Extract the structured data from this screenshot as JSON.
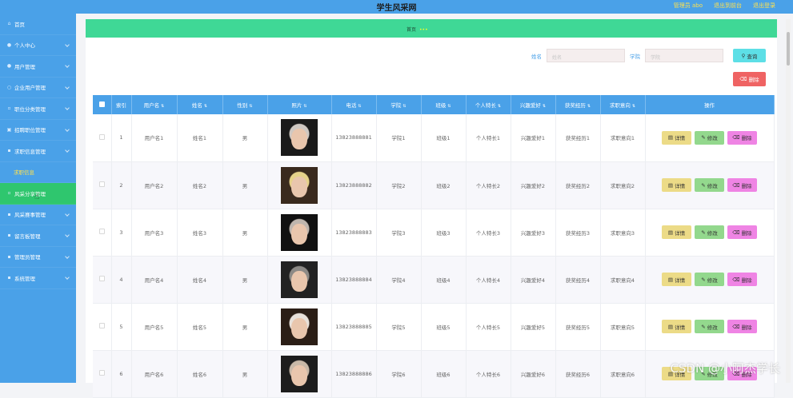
{
  "app": {
    "title": "学生风采网"
  },
  "header": {
    "admin_label": "管理员 abo",
    "exit_frontend": "退出到前台",
    "logout": "退出登录"
  },
  "sidebar": {
    "items": [
      {
        "label": "首页",
        "icon": "home-icon"
      },
      {
        "label": "个人中心",
        "icon": "user-icon"
      },
      {
        "label": "用户管理",
        "icon": "users-icon"
      },
      {
        "label": "企业用户管理",
        "icon": "building-icon"
      },
      {
        "label": "职位分类管理",
        "icon": "category-icon"
      },
      {
        "label": "招聘职位管理",
        "icon": "briefcase-icon"
      },
      {
        "label": "求职信息管理",
        "icon": "document-icon"
      },
      {
        "label": "求职信息",
        "icon": ""
      },
      {
        "label": "风采分享管理",
        "icon": "share-icon"
      },
      {
        "label": "风采赛事管理",
        "icon": "trophy-icon"
      },
      {
        "label": "留言板管理",
        "icon": "message-icon"
      },
      {
        "label": "管理员管理",
        "icon": "admin-icon"
      },
      {
        "label": "系统管理",
        "icon": "gear-icon"
      }
    ]
  },
  "breadcrumb": {
    "home": "首页",
    "current": "•••",
    "faded": ""
  },
  "search": {
    "name_label": "姓名",
    "name_placeholder": "姓名",
    "college_label": "学院",
    "college_placeholder": "学院",
    "button_label": "查询"
  },
  "actions": {
    "delete_label": "删除"
  },
  "table": {
    "headers": [
      "",
      "索引",
      "用户名",
      "姓名",
      "性别",
      "照片",
      "电话",
      "学院",
      "班级",
      "个人特长",
      "兴趣爱好",
      "获奖经历",
      "求职意向",
      "操作"
    ],
    "rows": [
      {
        "index": "1",
        "username": "用户名1",
        "name": "姓名1",
        "gender": "男",
        "phone": "13823888881",
        "college": "学院1",
        "class": "班级1",
        "talent": "个人特长1",
        "hobby": "兴趣爱好1",
        "award": "获奖经历1",
        "intent": "求职意向1"
      },
      {
        "index": "2",
        "username": "用户名2",
        "name": "姓名2",
        "gender": "男",
        "phone": "13823888882",
        "college": "学院2",
        "class": "班级2",
        "talent": "个人特长2",
        "hobby": "兴趣爱好2",
        "award": "获奖经历2",
        "intent": "求职意向2"
      },
      {
        "index": "3",
        "username": "用户名3",
        "name": "姓名3",
        "gender": "男",
        "phone": "13823888883",
        "college": "学院3",
        "class": "班级3",
        "talent": "个人特长3",
        "hobby": "兴趣爱好3",
        "award": "获奖经历3",
        "intent": "求职意向3"
      },
      {
        "index": "4",
        "username": "用户名4",
        "name": "姓名4",
        "gender": "男",
        "phone": "13823888884",
        "college": "学院4",
        "class": "班级4",
        "talent": "个人特长4",
        "hobby": "兴趣爱好4",
        "award": "获奖经历4",
        "intent": "求职意向4"
      },
      {
        "index": "5",
        "username": "用户名5",
        "name": "姓名5",
        "gender": "男",
        "phone": "13823888885",
        "college": "学院5",
        "class": "班级5",
        "talent": "个人特长5",
        "hobby": "兴趣爱好5",
        "award": "获奖经历5",
        "intent": "求职意向5"
      },
      {
        "index": "6",
        "username": "用户名6",
        "name": "姓名6",
        "gender": "男",
        "phone": "13823888886",
        "college": "学院6",
        "class": "班级6",
        "talent": "个人特长6",
        "hobby": "兴趣爱好6",
        "award": "获奖经历6",
        "intent": "求职意向6"
      }
    ],
    "op_labels": {
      "detail": "详情",
      "edit": "修改",
      "delete": "删除"
    }
  },
  "watermark": "CSDN @小阿杰学长",
  "colors": {
    "primary": "#4aa1e8",
    "banner": "#3fd896",
    "active": "#2fc66e",
    "accent_text": "#ffe14d"
  }
}
